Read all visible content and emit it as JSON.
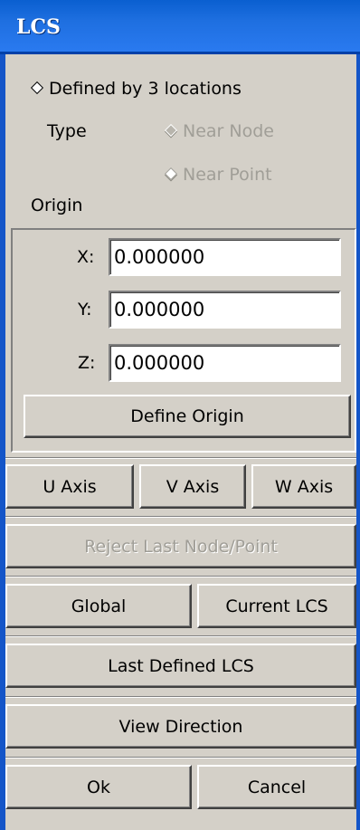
{
  "window": {
    "title": "LCS"
  },
  "method": {
    "label": "Defined by 3 locations"
  },
  "type": {
    "label": "Type",
    "options": [
      "Near Node",
      "Near Point"
    ]
  },
  "origin": {
    "label": "Origin",
    "x_label": "X:",
    "x_value": "0.000000",
    "y_label": "Y:",
    "y_value": "0.000000",
    "z_label": "Z:",
    "z_value": "0.000000",
    "define_button": "Define Origin"
  },
  "axes": {
    "u": "U Axis",
    "v": "V Axis",
    "w": "W Axis"
  },
  "buttons": {
    "reject": "Reject Last Node/Point",
    "global": "Global",
    "current": "Current LCS",
    "last_defined": "Last Defined LCS",
    "view_direction": "View Direction",
    "ok": "Ok",
    "cancel": "Cancel"
  }
}
